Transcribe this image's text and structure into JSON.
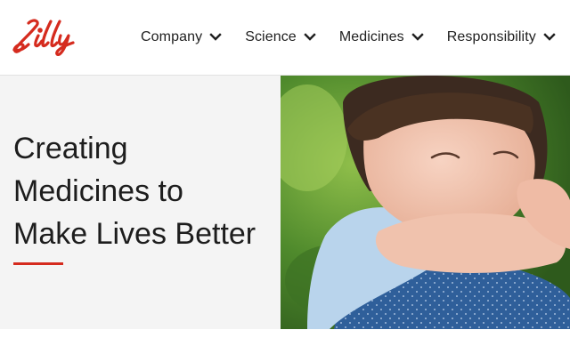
{
  "brand": {
    "logo_text": "Lilly",
    "accent_color": "#d52b1e"
  },
  "nav": {
    "items": [
      {
        "label": "Company",
        "icon": "chevron-down-icon"
      },
      {
        "label": "Science",
        "icon": "chevron-down-icon"
      },
      {
        "label": "Medicines",
        "icon": "chevron-down-icon"
      },
      {
        "label": "Responsibility",
        "icon": "chevron-down-icon"
      }
    ]
  },
  "hero": {
    "title_lines": [
      "Creating",
      "Medicines to",
      "Make Lives Better"
    ],
    "image": "photo-child-hugging-adult"
  }
}
